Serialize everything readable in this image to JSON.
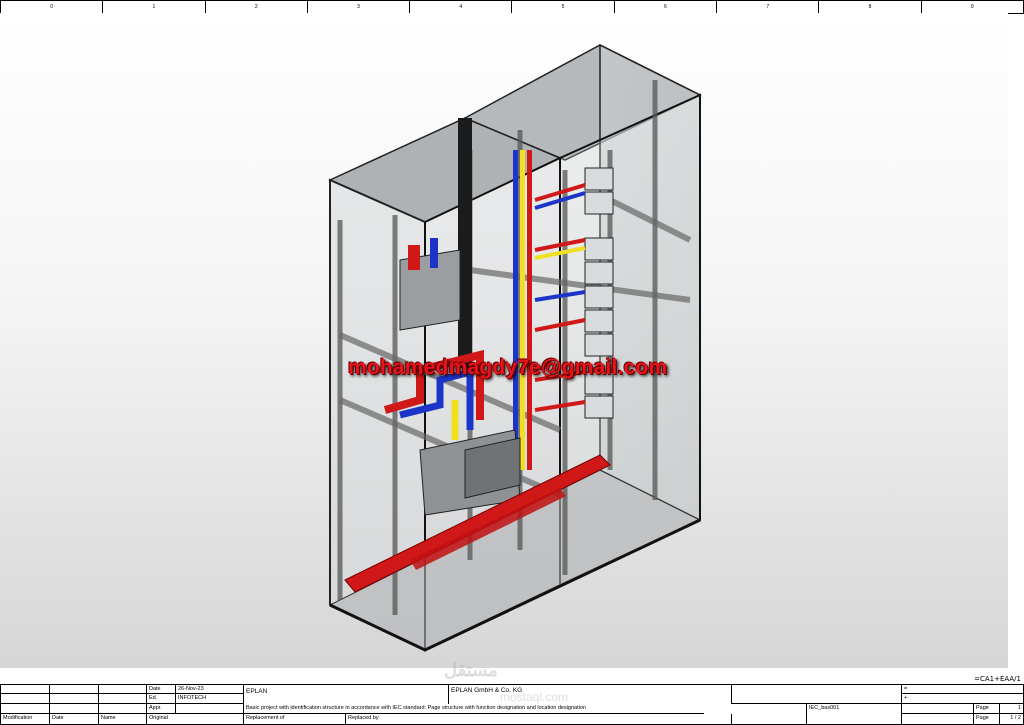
{
  "ruler": {
    "columns": [
      "0",
      "1",
      "2",
      "3",
      "4",
      "5",
      "6",
      "7",
      "8",
      "9"
    ]
  },
  "drawing": {
    "alt": "3D isometric view of a two-bay switchgear cabinet",
    "watermark_email": "mohamedmagdy7e@gmail.com",
    "watermark_logo": "مستقل",
    "watermark_logo_sub": "mostaql.com"
  },
  "placeholder_tag": "=CA1+EAA/1",
  "titleblock": {
    "labels": {
      "date": "Date",
      "ed": "Ed.",
      "appr": "Appr.",
      "modification": "Modification",
      "date_col": "Date",
      "name_col": "Name",
      "original": "Original",
      "replacement_of": "Replacement of",
      "replaced_by": "Replaced by",
      "page": "Page"
    },
    "date_value": "26-Nov-23",
    "ed_value": "INFOTECH",
    "brand": "EPLAN",
    "description": "Basic project with identification structure in accordance with IEC standard: Page structure with function designation and location designation",
    "company": "EPLAN GmbH & Co. KG",
    "equals_sign": "=",
    "plus_sign": "+",
    "drawing_no": "IEC_bas001",
    "page_no": "1",
    "page_of": "1 / 2"
  },
  "colors": {
    "busbar_red": "#d01818",
    "busbar_blue": "#1c35c8",
    "busbar_yellow": "#f0e020",
    "frame_dark": "#2a2a2a"
  }
}
